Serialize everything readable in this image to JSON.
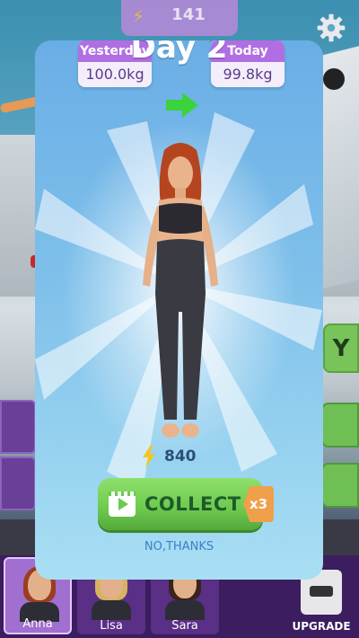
{
  "top_bar": {
    "energy_total": "141"
  },
  "modal": {
    "title": "Day 2",
    "yesterday": {
      "label": "Yesterday",
      "value": "100.0kg"
    },
    "today": {
      "label": "Today",
      "value": "99.8kg"
    },
    "reward": {
      "energy_amount": "840"
    },
    "collect_button": {
      "label": "COLLECT",
      "multiplier": "x3"
    },
    "dismiss_label": "NO,THANKS"
  },
  "side_panel": {
    "right_badge": "Y"
  },
  "characters": [
    {
      "name": "Anna",
      "selected": true
    },
    {
      "name": "Lisa",
      "selected": false
    },
    {
      "name": "Sara",
      "selected": false
    }
  ],
  "upgrade": {
    "label": "UPGRADE"
  },
  "colors": {
    "modal_top": "#6aaee6",
    "modal_bottom": "#a9dff4",
    "weight_header": "#b06ee3",
    "collect_green": "#6cc94e",
    "multiplier_orange": "#f0a04a",
    "arrow_green": "#3bd33b",
    "bolt_yellow": "#f3c427"
  },
  "icons": {
    "settings": "gear-icon",
    "energy": "lightning-bolt-icon",
    "progress_arrow": "arrow-right-icon",
    "video": "video-ad-icon",
    "upgrade": "dumbbell-icon"
  }
}
